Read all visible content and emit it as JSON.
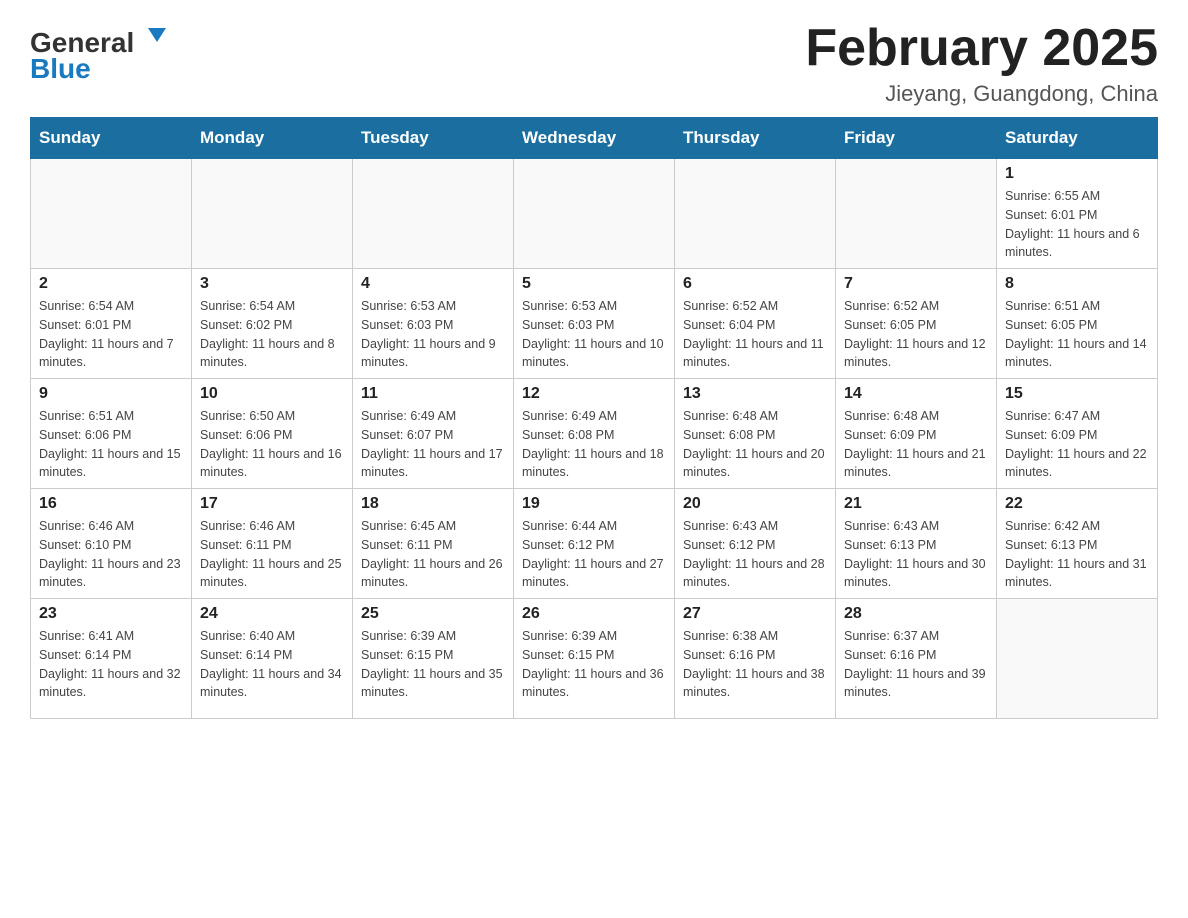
{
  "logo": {
    "general": "General",
    "blue": "Blue"
  },
  "header": {
    "month": "February 2025",
    "location": "Jieyang, Guangdong, China"
  },
  "days_of_week": [
    "Sunday",
    "Monday",
    "Tuesday",
    "Wednesday",
    "Thursday",
    "Friday",
    "Saturday"
  ],
  "weeks": [
    [
      {
        "day": "",
        "sunrise": "",
        "sunset": "",
        "daylight": "",
        "empty": true
      },
      {
        "day": "",
        "sunrise": "",
        "sunset": "",
        "daylight": "",
        "empty": true
      },
      {
        "day": "",
        "sunrise": "",
        "sunset": "",
        "daylight": "",
        "empty": true
      },
      {
        "day": "",
        "sunrise": "",
        "sunset": "",
        "daylight": "",
        "empty": true
      },
      {
        "day": "",
        "sunrise": "",
        "sunset": "",
        "daylight": "",
        "empty": true
      },
      {
        "day": "",
        "sunrise": "",
        "sunset": "",
        "daylight": "",
        "empty": true
      },
      {
        "day": "1",
        "sunrise": "Sunrise: 6:55 AM",
        "sunset": "Sunset: 6:01 PM",
        "daylight": "Daylight: 11 hours and 6 minutes.",
        "empty": false
      }
    ],
    [
      {
        "day": "2",
        "sunrise": "Sunrise: 6:54 AM",
        "sunset": "Sunset: 6:01 PM",
        "daylight": "Daylight: 11 hours and 7 minutes.",
        "empty": false
      },
      {
        "day": "3",
        "sunrise": "Sunrise: 6:54 AM",
        "sunset": "Sunset: 6:02 PM",
        "daylight": "Daylight: 11 hours and 8 minutes.",
        "empty": false
      },
      {
        "day": "4",
        "sunrise": "Sunrise: 6:53 AM",
        "sunset": "Sunset: 6:03 PM",
        "daylight": "Daylight: 11 hours and 9 minutes.",
        "empty": false
      },
      {
        "day": "5",
        "sunrise": "Sunrise: 6:53 AM",
        "sunset": "Sunset: 6:03 PM",
        "daylight": "Daylight: 11 hours and 10 minutes.",
        "empty": false
      },
      {
        "day": "6",
        "sunrise": "Sunrise: 6:52 AM",
        "sunset": "Sunset: 6:04 PM",
        "daylight": "Daylight: 11 hours and 11 minutes.",
        "empty": false
      },
      {
        "day": "7",
        "sunrise": "Sunrise: 6:52 AM",
        "sunset": "Sunset: 6:05 PM",
        "daylight": "Daylight: 11 hours and 12 minutes.",
        "empty": false
      },
      {
        "day": "8",
        "sunrise": "Sunrise: 6:51 AM",
        "sunset": "Sunset: 6:05 PM",
        "daylight": "Daylight: 11 hours and 14 minutes.",
        "empty": false
      }
    ],
    [
      {
        "day": "9",
        "sunrise": "Sunrise: 6:51 AM",
        "sunset": "Sunset: 6:06 PM",
        "daylight": "Daylight: 11 hours and 15 minutes.",
        "empty": false
      },
      {
        "day": "10",
        "sunrise": "Sunrise: 6:50 AM",
        "sunset": "Sunset: 6:06 PM",
        "daylight": "Daylight: 11 hours and 16 minutes.",
        "empty": false
      },
      {
        "day": "11",
        "sunrise": "Sunrise: 6:49 AM",
        "sunset": "Sunset: 6:07 PM",
        "daylight": "Daylight: 11 hours and 17 minutes.",
        "empty": false
      },
      {
        "day": "12",
        "sunrise": "Sunrise: 6:49 AM",
        "sunset": "Sunset: 6:08 PM",
        "daylight": "Daylight: 11 hours and 18 minutes.",
        "empty": false
      },
      {
        "day": "13",
        "sunrise": "Sunrise: 6:48 AM",
        "sunset": "Sunset: 6:08 PM",
        "daylight": "Daylight: 11 hours and 20 minutes.",
        "empty": false
      },
      {
        "day": "14",
        "sunrise": "Sunrise: 6:48 AM",
        "sunset": "Sunset: 6:09 PM",
        "daylight": "Daylight: 11 hours and 21 minutes.",
        "empty": false
      },
      {
        "day": "15",
        "sunrise": "Sunrise: 6:47 AM",
        "sunset": "Sunset: 6:09 PM",
        "daylight": "Daylight: 11 hours and 22 minutes.",
        "empty": false
      }
    ],
    [
      {
        "day": "16",
        "sunrise": "Sunrise: 6:46 AM",
        "sunset": "Sunset: 6:10 PM",
        "daylight": "Daylight: 11 hours and 23 minutes.",
        "empty": false
      },
      {
        "day": "17",
        "sunrise": "Sunrise: 6:46 AM",
        "sunset": "Sunset: 6:11 PM",
        "daylight": "Daylight: 11 hours and 25 minutes.",
        "empty": false
      },
      {
        "day": "18",
        "sunrise": "Sunrise: 6:45 AM",
        "sunset": "Sunset: 6:11 PM",
        "daylight": "Daylight: 11 hours and 26 minutes.",
        "empty": false
      },
      {
        "day": "19",
        "sunrise": "Sunrise: 6:44 AM",
        "sunset": "Sunset: 6:12 PM",
        "daylight": "Daylight: 11 hours and 27 minutes.",
        "empty": false
      },
      {
        "day": "20",
        "sunrise": "Sunrise: 6:43 AM",
        "sunset": "Sunset: 6:12 PM",
        "daylight": "Daylight: 11 hours and 28 minutes.",
        "empty": false
      },
      {
        "day": "21",
        "sunrise": "Sunrise: 6:43 AM",
        "sunset": "Sunset: 6:13 PM",
        "daylight": "Daylight: 11 hours and 30 minutes.",
        "empty": false
      },
      {
        "day": "22",
        "sunrise": "Sunrise: 6:42 AM",
        "sunset": "Sunset: 6:13 PM",
        "daylight": "Daylight: 11 hours and 31 minutes.",
        "empty": false
      }
    ],
    [
      {
        "day": "23",
        "sunrise": "Sunrise: 6:41 AM",
        "sunset": "Sunset: 6:14 PM",
        "daylight": "Daylight: 11 hours and 32 minutes.",
        "empty": false
      },
      {
        "day": "24",
        "sunrise": "Sunrise: 6:40 AM",
        "sunset": "Sunset: 6:14 PM",
        "daylight": "Daylight: 11 hours and 34 minutes.",
        "empty": false
      },
      {
        "day": "25",
        "sunrise": "Sunrise: 6:39 AM",
        "sunset": "Sunset: 6:15 PM",
        "daylight": "Daylight: 11 hours and 35 minutes.",
        "empty": false
      },
      {
        "day": "26",
        "sunrise": "Sunrise: 6:39 AM",
        "sunset": "Sunset: 6:15 PM",
        "daylight": "Daylight: 11 hours and 36 minutes.",
        "empty": false
      },
      {
        "day": "27",
        "sunrise": "Sunrise: 6:38 AM",
        "sunset": "Sunset: 6:16 PM",
        "daylight": "Daylight: 11 hours and 38 minutes.",
        "empty": false
      },
      {
        "day": "28",
        "sunrise": "Sunrise: 6:37 AM",
        "sunset": "Sunset: 6:16 PM",
        "daylight": "Daylight: 11 hours and 39 minutes.",
        "empty": false
      },
      {
        "day": "",
        "sunrise": "",
        "sunset": "",
        "daylight": "",
        "empty": true
      }
    ]
  ]
}
